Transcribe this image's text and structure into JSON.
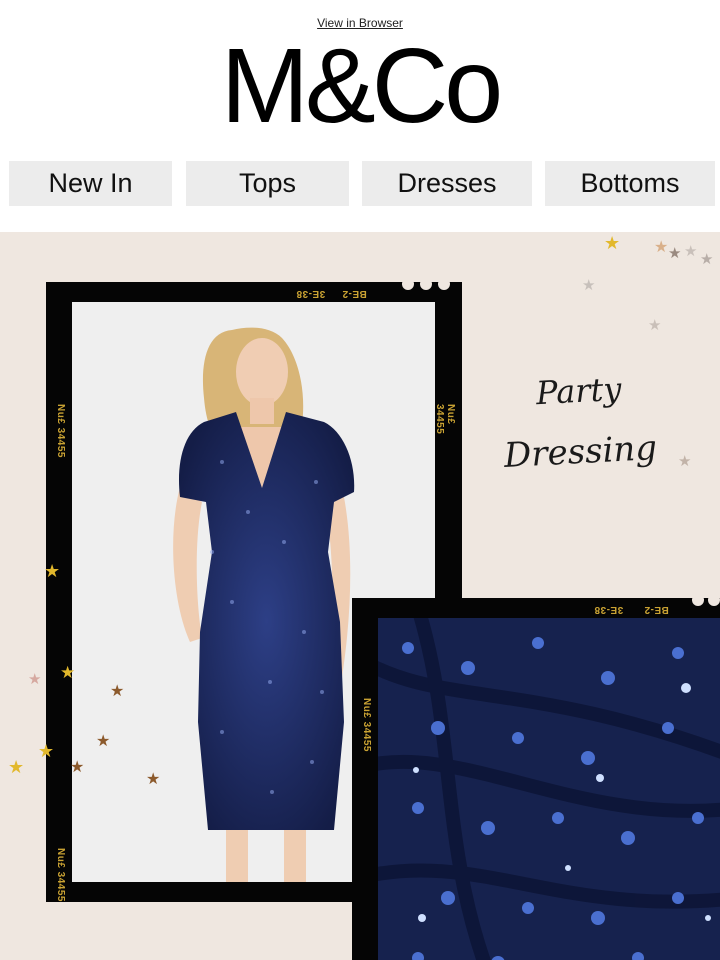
{
  "header": {
    "view_in_browser": "View in Browser",
    "logo_text": "M&Co"
  },
  "nav": {
    "items": [
      {
        "label": "New In"
      },
      {
        "label": "Tops"
      },
      {
        "label": "Dresses"
      },
      {
        "label": "Bottoms"
      }
    ]
  },
  "hero": {
    "headline_line1": "Party",
    "headline_line2": "Dressing",
    "film_code_a": "BE-2",
    "film_code_b": "3E-38",
    "film_code_side": "Nu£ 34455",
    "colors": {
      "background": "#efe7e0",
      "film": "#050505",
      "film_text": "#c9a233",
      "dress": "#1b2a5e"
    }
  },
  "icons": [
    "star-icon"
  ]
}
